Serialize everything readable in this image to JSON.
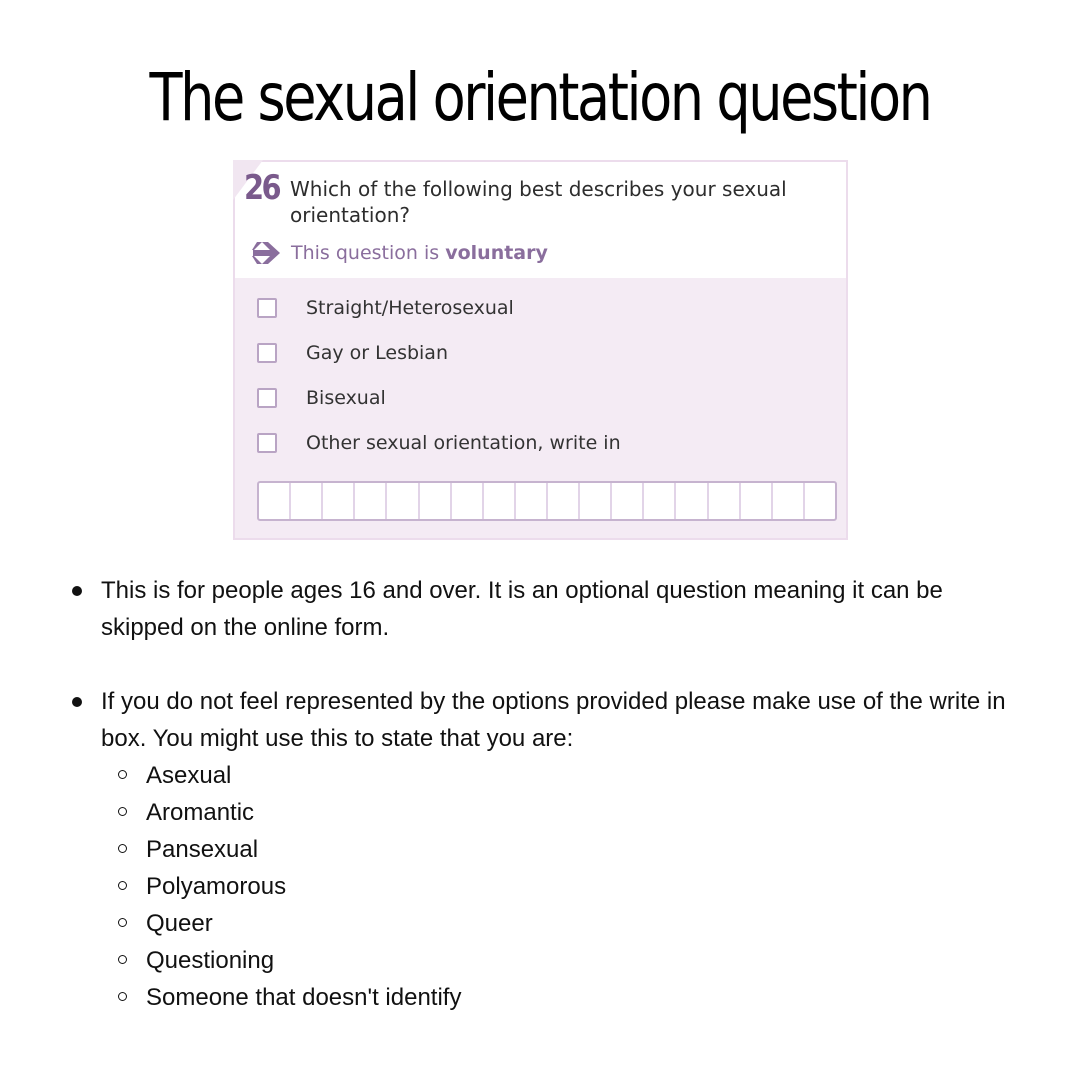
{
  "title": "The sexual orientation question",
  "form": {
    "number": "26",
    "question": "Which of the following best describes your sexual orientation?",
    "voluntary_prefix": "This question is ",
    "voluntary_bold": "voluntary",
    "options": [
      "Straight/Heterosexual",
      "Gay or Lesbian",
      "Bisexual",
      "Other sexual orientation, write in"
    ],
    "write_in_value": ""
  },
  "notes": {
    "bullet1": "This is for people ages 16 and over. It is an optional question meaning it can be skipped on the online form.",
    "bullet2": "If you do not feel represented by the options provided please make use of the write in box. You might use this to state that you are:",
    "examples": [
      "Asexual",
      "Aromantic",
      "Pansexual",
      "Polyamorous",
      "Queer",
      "Questioning",
      "Someone that doesn't identify"
    ]
  },
  "colors": {
    "accent": "#7a5a8c",
    "panel": "#f4ebf4"
  },
  "icons": {
    "voluntary": "right-arrow-icon"
  }
}
